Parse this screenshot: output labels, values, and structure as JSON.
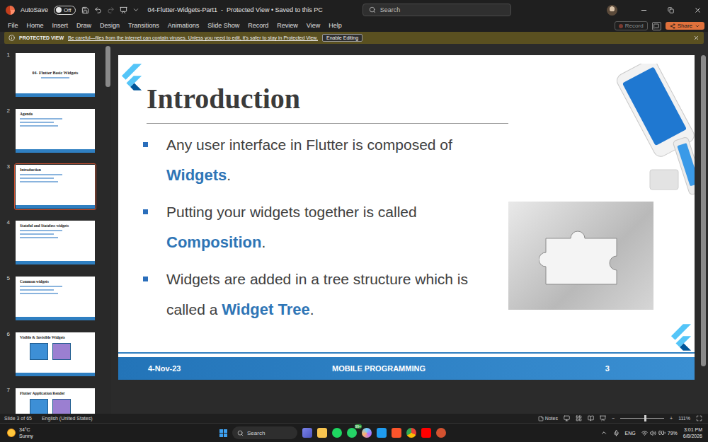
{
  "window": {
    "title": "04-Flutter-Widgets-Part1  -  Protected View • Saved to this PC",
    "autosave": {
      "label": "AutoSave",
      "state": "Off",
      "on": false
    },
    "search": {
      "placeholder": "Search"
    }
  },
  "ribbon": {
    "tabs": [
      {
        "label": "File",
        "selected": false
      },
      {
        "label": "Home",
        "selected": false
      },
      {
        "label": "Insert",
        "selected": false
      },
      {
        "label": "Draw",
        "selected": false
      },
      {
        "label": "Design",
        "selected": false
      },
      {
        "label": "Transitions",
        "selected": false
      },
      {
        "label": "Animations",
        "selected": false
      },
      {
        "label": "Slide Show",
        "selected": false
      },
      {
        "label": "Record",
        "selected": false
      },
      {
        "label": "Review",
        "selected": false
      },
      {
        "label": "View",
        "selected": false
      },
      {
        "label": "Help",
        "selected": false
      }
    ],
    "record": "Record",
    "share": "Share"
  },
  "message_bar": {
    "label": "PROTECTED VIEW",
    "message": "Be careful—files from the internet can contain viruses. Unless you need to edit, it's safer to stay in Protected View.",
    "button": "Enable Editing"
  },
  "thumbnails": [
    {
      "number": "1",
      "title": "04- Flutter Basic Widgets",
      "kind": "title",
      "selected": false
    },
    {
      "number": "2",
      "title": "Agenda",
      "kind": "content",
      "selected": false
    },
    {
      "number": "3",
      "title": "Introduction",
      "kind": "content",
      "selected": true
    },
    {
      "number": "4",
      "title": "Stateful and Stateless widgets",
      "kind": "content",
      "selected": false
    },
    {
      "number": "5",
      "title": "Common widgets",
      "kind": "content",
      "selected": false
    },
    {
      "number": "6",
      "title": "Visible & Invisible Widgets",
      "kind": "diagram",
      "selected": false
    },
    {
      "number": "7",
      "title": "Flutter Application Render",
      "kind": "diagram",
      "selected": false
    }
  ],
  "slide": {
    "title": "Introduction",
    "bullets": [
      {
        "parts": [
          {
            "text": "Any user interface in Flutter is composed of ",
            "emphasis": false
          },
          {
            "text": "Widgets",
            "emphasis": true
          },
          {
            "text": ".",
            "emphasis": false
          }
        ]
      },
      {
        "parts": [
          {
            "text": "Putting your widgets together is called ",
            "emphasis": false
          },
          {
            "text": "Composition",
            "emphasis": true
          },
          {
            "text": ".",
            "emphasis": false
          }
        ]
      },
      {
        "parts": [
          {
            "text": "Widgets are added in a tree structure which is called a ",
            "emphasis": false
          },
          {
            "text": "Widget Tree",
            "emphasis": true
          },
          {
            "text": ".",
            "emphasis": false
          }
        ]
      }
    ],
    "footer": {
      "date": "4-Nov-23",
      "course": "MOBILE PROGRAMMING",
      "page": "3"
    }
  },
  "status_bar": {
    "position": "Slide 3 of 65",
    "language": "English (United States)",
    "notes": "Notes",
    "zoom_out": "−",
    "zoom_in": "+",
    "zoom": "111%",
    "zoom_level": 0.55
  },
  "taskbar": {
    "weather": {
      "temperature": "34°C",
      "condition": "Sunny"
    },
    "search": "Search",
    "badge": "99+",
    "language": "ENG",
    "battery": "79%",
    "time": "3:01 PM",
    "date": "6/8/2026"
  }
}
